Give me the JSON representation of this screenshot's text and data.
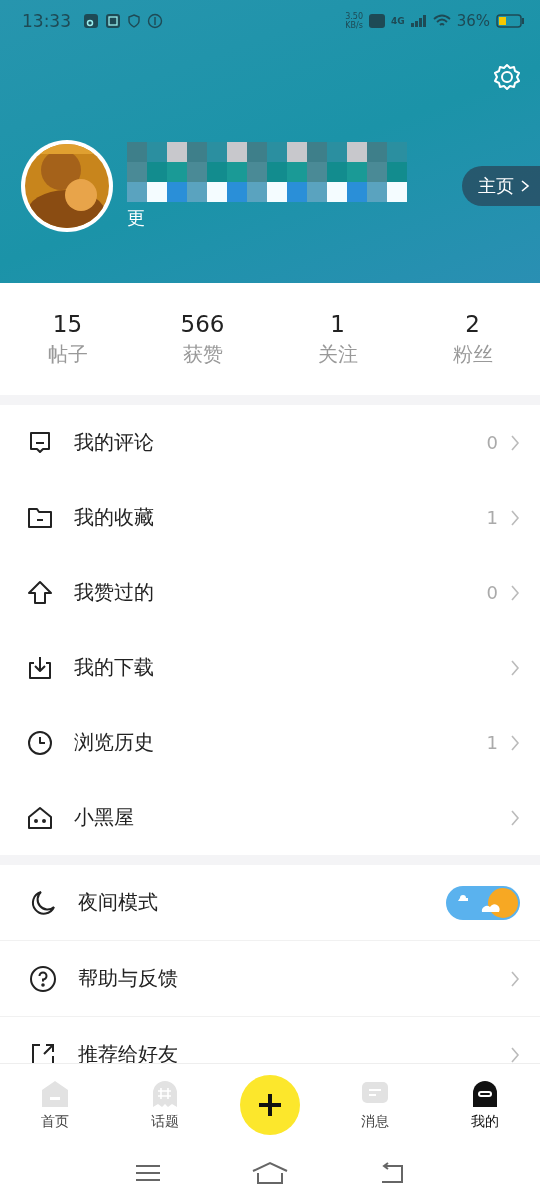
{
  "status_bar": {
    "time": "13:33",
    "speed": "3.50",
    "speed_unit": "KB/s",
    "network": "4G",
    "battery": "36%"
  },
  "profile": {
    "bio_fragment": "更",
    "home_button": "主页"
  },
  "stats": [
    {
      "value": "15",
      "label": "帖子"
    },
    {
      "value": "566",
      "label": "获赞"
    },
    {
      "value": "1",
      "label": "关注"
    },
    {
      "value": "2",
      "label": "粉丝"
    }
  ],
  "menu": [
    {
      "kind": "comment",
      "label": "我的评论",
      "count": "0"
    },
    {
      "kind": "folder",
      "label": "我的收藏",
      "count": "1"
    },
    {
      "kind": "like",
      "label": "我赞过的",
      "count": "0"
    },
    {
      "kind": "download",
      "label": "我的下载"
    },
    {
      "kind": "history",
      "label": "浏览历史",
      "count": "1"
    },
    {
      "kind": "house",
      "label": "小黑屋"
    }
  ],
  "settings": [
    {
      "kind": "toggle",
      "label": "夜间模式",
      "on": true
    },
    {
      "kind": "link",
      "label": "帮助与反馈"
    },
    {
      "kind": "link",
      "label": "推荐给好友"
    }
  ],
  "tabs": [
    {
      "kind": "home",
      "label": "首页",
      "selected": false
    },
    {
      "kind": "topic",
      "label": "话题",
      "selected": false
    },
    {
      "kind": "add"
    },
    {
      "kind": "message",
      "label": "消息",
      "selected": false
    },
    {
      "kind": "me",
      "label": "我的",
      "selected": true
    }
  ]
}
